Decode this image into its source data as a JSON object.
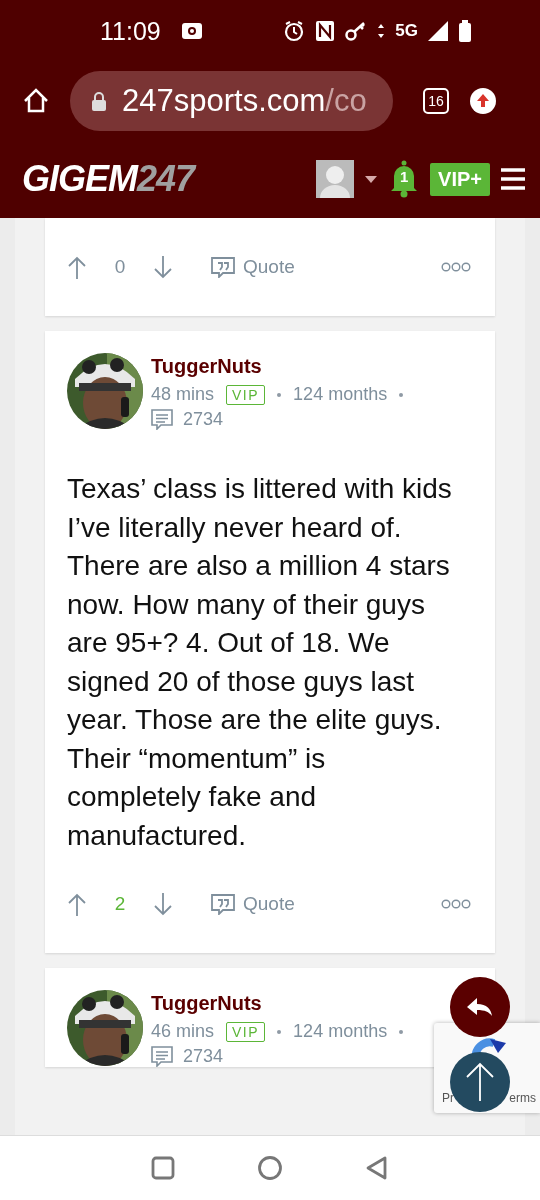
{
  "status_bar": {
    "time": "11:09",
    "network": "5G"
  },
  "browser": {
    "url_host": "247sports.com",
    "url_path": "/co",
    "tab_count": "16"
  },
  "site_header": {
    "logo_main": "GIGEM",
    "logo_number": "247",
    "notification_count": "1",
    "vip_label": "VIP+"
  },
  "posts": [
    {
      "score": "0",
      "voted_up": false,
      "quote_label": "Quote"
    },
    {
      "author": "TuggerNuts",
      "time": "48 mins",
      "badge": "VIP",
      "tenure": "124 months",
      "post_count": "2734",
      "body": "Texas’ class is littered with kids I’ve literally never heard of. There are also a million 4 stars now. How many of their guys are 95+? 4. Out of 18. We signed 20 of those guys last year. Those are the elite guys. Their “momentum” is completely fake and manufactured.",
      "score": "2",
      "voted_up": true,
      "quote_label": "Quote"
    },
    {
      "author": "TuggerNuts",
      "time": "46 mins",
      "badge": "VIP",
      "tenure": "124 months",
      "post_count": "2734"
    }
  ],
  "recaptcha": {
    "left_text": "Pr",
    "right_text": "erms"
  }
}
